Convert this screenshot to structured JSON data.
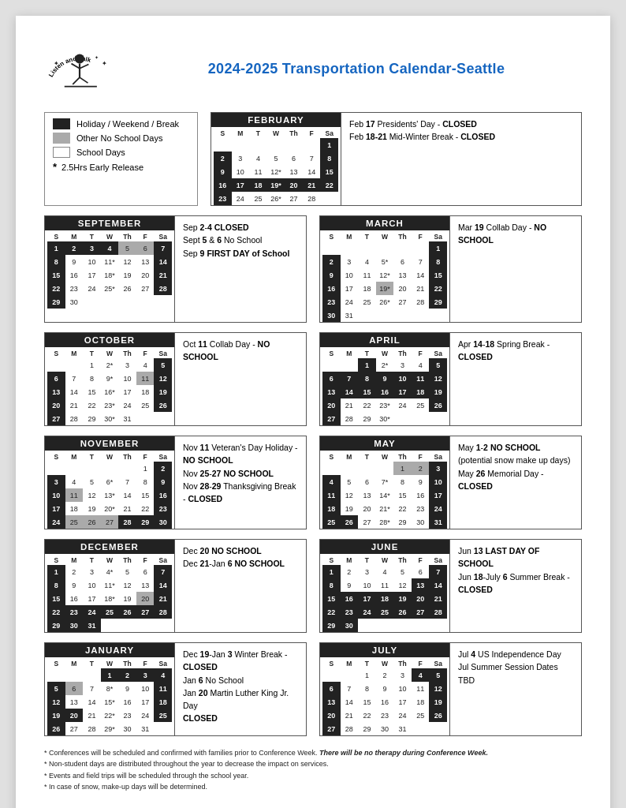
{
  "title": "2024-2025 Transportation Calendar-Seattle",
  "legend": {
    "items": [
      {
        "swatch": "black",
        "label": "Holiday / Weekend / Break"
      },
      {
        "swatch": "gray",
        "label": "Other No School Days"
      },
      {
        "swatch": "white",
        "label": "School Days"
      },
      {
        "star": true,
        "label": "2.5Hrs Early Release"
      }
    ]
  },
  "months": [
    {
      "name": "SEPTEMBER",
      "year": 2024,
      "startDow": 0,
      "days": 30,
      "notes": "Sep 2-4 CLOSED\nSept 5 & 6 No School\nSep 9 FIRST DAY of School",
      "blackDays": [
        1,
        2,
        3,
        4,
        5,
        6,
        7,
        8,
        14,
        21,
        22,
        28
      ],
      "grayDays": [
        5,
        6
      ],
      "starDays": [
        11,
        18,
        25
      ],
      "boldDays": []
    },
    {
      "name": "FEBRUARY",
      "year": 2025,
      "startDow": 6,
      "days": 28,
      "notes": "Feb 17 Presidents' Day - CLOSED\nFeb 18-21 Mid-Winter Break - CLOSED",
      "blackDays": [
        1,
        2,
        8,
        9,
        15,
        16,
        17,
        18,
        19,
        20,
        21,
        22,
        23
      ],
      "grayDays": [],
      "starDays": [
        12,
        19,
        26
      ],
      "boldDays": []
    },
    {
      "name": "OCTOBER",
      "year": 2024,
      "startDow": 2,
      "days": 31,
      "notes": "Oct 11 Collab Day - NO SCHOOL",
      "blackDays": [
        5,
        6,
        11,
        12,
        13,
        19,
        20,
        26,
        27
      ],
      "grayDays": [
        11
      ],
      "starDays": [
        2,
        9,
        16,
        23,
        30
      ],
      "boldDays": []
    },
    {
      "name": "MARCH",
      "year": 2025,
      "startDow": 6,
      "days": 31,
      "notes": "Mar 19 Collab Day - NO SCHOOL",
      "blackDays": [
        1,
        2,
        8,
        9,
        15,
        16,
        22,
        23,
        29,
        30,
        19
      ],
      "grayDays": [
        19
      ],
      "starDays": [
        5,
        12,
        19,
        26
      ],
      "boldDays": []
    },
    {
      "name": "NOVEMBER",
      "year": 2024,
      "startDow": 5,
      "days": 30,
      "notes": "Nov 11 Veteran's Day Holiday - NO SCHOOL\nNov 25-27 NO SCHOOL\nNov 28-29 Thanksgiving Break - CLOSED",
      "blackDays": [
        2,
        3,
        9,
        10,
        11,
        16,
        17,
        23,
        24,
        25,
        26,
        27,
        28,
        29,
        30
      ],
      "grayDays": [
        11,
        25,
        26,
        27
      ],
      "starDays": [
        6,
        13,
        20
      ],
      "boldDays": []
    },
    {
      "name": "MAY",
      "year": 2025,
      "startDow": 4,
      "days": 31,
      "notes": "May 1-2 NO SCHOOL (potential snow make up days)\nMay 26 Memorial Day - CLOSED",
      "blackDays": [
        3,
        4,
        10,
        11,
        17,
        18,
        24,
        25,
        26,
        31
      ],
      "grayDays": [
        1,
        2
      ],
      "starDays": [
        7,
        14,
        21,
        28
      ],
      "boldDays": []
    },
    {
      "name": "DECEMBER",
      "year": 2024,
      "startDow": 0,
      "days": 31,
      "notes": "Dec 20 NO SCHOOL\nDec 21-Jan 6 NO SCHOOL",
      "blackDays": [
        1,
        7,
        8,
        14,
        15,
        20,
        21,
        22,
        23,
        24,
        25,
        26,
        27,
        28,
        29,
        30,
        31
      ],
      "grayDays": [
        20
      ],
      "starDays": [
        4,
        11,
        18
      ],
      "boldDays": []
    },
    {
      "name": "JUNE",
      "year": 2025,
      "startDow": 0,
      "days": 30,
      "notes": "Jun 13 LAST DAY OF SCHOOL\nJun 18-July 6 Summer Break - CLOSED",
      "blackDays": [
        1,
        7,
        8,
        13,
        14,
        15,
        16,
        17,
        18,
        19,
        20,
        21,
        22,
        23,
        24,
        25,
        26,
        27,
        28,
        29,
        30
      ],
      "grayDays": [],
      "starDays": [],
      "boldDays": [
        13
      ]
    },
    {
      "name": "JANUARY",
      "year": 2025,
      "startDow": 3,
      "days": 31,
      "notes": "Dec 19-Jan 3 Winter Break - CLOSED\nJan 6 No School\nJan 20 Martin Luther King Jr. Day\nCLOSED",
      "blackDays": [
        1,
        2,
        3,
        4,
        5,
        6,
        11,
        12,
        18,
        19,
        20,
        25,
        26
      ],
      "grayDays": [
        6
      ],
      "starDays": [
        8,
        15,
        22,
        29
      ],
      "boldDays": []
    },
    {
      "name": "JULY",
      "year": 2025,
      "startDow": 2,
      "days": 31,
      "notes": "Jul 4 US Independence Day\nJul Summer Session Dates TBD",
      "blackDays": [
        4,
        5,
        6,
        12,
        13,
        19,
        20,
        26,
        27
      ],
      "grayDays": [],
      "starDays": [],
      "boldDays": []
    }
  ],
  "footnotes": [
    "* Conferences will be scheduled and confirmed with families prior to Conference Week. There will be no therapy during Conference Week.",
    "* Non-student days are distributed throughout the year to decrease the impact on services.",
    "* Events and field trips will be scheduled through the school year.",
    "* In case of snow, make-up days will be determined."
  ]
}
